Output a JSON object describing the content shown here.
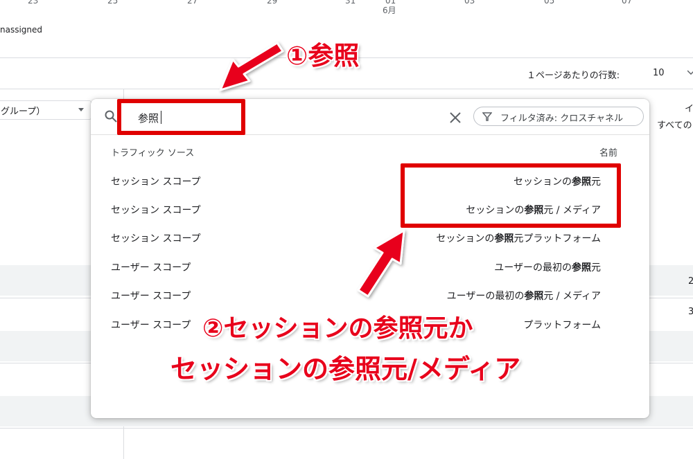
{
  "chart_axis": {
    "ticks": [
      "23",
      "25",
      "27",
      "29",
      "31",
      "01",
      "03",
      "05",
      "07"
    ],
    "month_label": "6月"
  },
  "legend": {
    "unassigned_label": "nassigned"
  },
  "pagination": {
    "rows_per_page_label": "１ページあたりの行数:",
    "rows_per_page_value": "10"
  },
  "dimension_selector": {
    "label": "グループ）"
  },
  "right_partial": {
    "col_header_top": "イ",
    "col_header_sub": "すべての",
    "cell_1": "2",
    "cell_2": "3"
  },
  "search": {
    "value": "参照",
    "filter_chip": "フィルタ済み: クロスチャネル"
  },
  "list": {
    "header_left": "トラフィック ソース",
    "header_right": "名前",
    "rows": [
      {
        "scope": "セッション スコープ",
        "name_pre": "セッションの",
        "name_bold": "参照",
        "name_post": "元"
      },
      {
        "scope": "セッション スコープ",
        "name_pre": "セッションの",
        "name_bold": "参照",
        "name_post": "元 / メディア"
      },
      {
        "scope": "セッション スコープ",
        "name_pre": "セッションの",
        "name_bold": "参照",
        "name_post": "元プラットフォーム"
      },
      {
        "scope": "ユーザー スコープ",
        "name_pre": "ユーザーの最初の",
        "name_bold": "参照",
        "name_post": "元"
      },
      {
        "scope": "ユーザー スコープ",
        "name_pre": "ユーザーの最初の",
        "name_bold": "参照",
        "name_post": "元 / メディア"
      },
      {
        "scope": "ユーザー スコープ",
        "name_pre": "",
        "name_bold": "",
        "name_post": "プラットフォーム"
      }
    ]
  },
  "annotations": {
    "step1": "①参照",
    "step2_line1": "②セッションの参照元か",
    "step2_line2": "セッションの参照元/メディア"
  },
  "colors": {
    "annotation_red": "#e8001b",
    "box_red": "#e00000"
  }
}
